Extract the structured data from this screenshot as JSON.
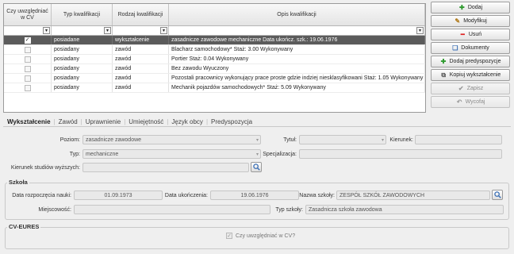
{
  "grid": {
    "headers": [
      "Czy uwzględniać w CV",
      "Typ kwalifikacji",
      "Rodzaj kwalifikacji",
      "Opis kwalifikacji"
    ],
    "rows": [
      {
        "checked": true,
        "typ": "posiadane",
        "rodzaj": "wykształcenie",
        "opis": "zasadnicze zawodowe mechaniczne   Data ukończ. szk.: 19.06.1976",
        "selected": true
      },
      {
        "checked": false,
        "typ": "posiadany",
        "rodzaj": "zawód",
        "opis": "Blacharz samochodowy* Staż: 3.00 Wykonywany",
        "selected": false
      },
      {
        "checked": false,
        "typ": "posiadany",
        "rodzaj": "zawód",
        "opis": "Portier Staż: 0.04 Wykonywany",
        "selected": false
      },
      {
        "checked": false,
        "typ": "posiadany",
        "rodzaj": "zawód",
        "opis": "Bez zawodu Wyuczony",
        "selected": false
      },
      {
        "checked": false,
        "typ": "posiadany",
        "rodzaj": "zawód",
        "opis": "Pozostali pracownicy wykonujący prace proste gdzie indziej niesklasyfikowani Staż: 1.05 Wykonywany",
        "selected": false
      },
      {
        "checked": false,
        "typ": "posiadany",
        "rodzaj": "zawód",
        "opis": "Mechanik pojazdów samochodowych* Staż: 5.09 Wykonywany",
        "selected": false
      }
    ]
  },
  "buttons": {
    "dodaj": "Dodaj",
    "modyfikuj": "Modyfikuj",
    "usun": "Usuń",
    "dokumenty": "Dokumenty",
    "dodaj_predyspozycje": "Dodaj predyspozycje",
    "kopiuj": "Kopiuj wykształcenie",
    "zapisz": "Zapisz",
    "wycofaj": "Wycofaj"
  },
  "tabs": [
    "Wykształcenie",
    "Zawód",
    "Uprawnienie",
    "Umiejętność",
    "Język obcy",
    "Predyspozycja"
  ],
  "form": {
    "poziom_label": "Poziom:",
    "poziom_value": "zasadnicze zawodowe",
    "tytul_label": "Tytuł:",
    "tytul_value": "",
    "kierunek_label": "Kierunek:",
    "kierunek_value": "",
    "typ_label": "Typ:",
    "typ_value": "mechaniczne",
    "specjalizacja_label": "Specjalizacja:",
    "specjalizacja_value": "",
    "kierunek_studiow_label": "Kierunek studiów wyższych:",
    "kierunek_studiow_value": ""
  },
  "szkola": {
    "title": "Szkoła",
    "data_rozp_label": "Data rozpoczęcia nauki:",
    "data_rozp_value": "01.09.1973",
    "data_ukon_label": "Data ukończenia:",
    "data_ukon_value": "19.06.1976",
    "nazwa_label": "Nazwa szkoły:",
    "nazwa_value": "ZESPÓŁ SZKÓŁ ZAWODOWYCH",
    "miejscowosc_label": "Miejscowość:",
    "miejscowosc_value": "",
    "typ_szkoly_label": "Typ szkoły:",
    "typ_szkoly_value": "Zasadnicza szkoła zawodowa"
  },
  "cv_eures": {
    "title": "CV-EURES",
    "checkbox_label": "Czy uwzględniać w CV?",
    "checked": true
  }
}
